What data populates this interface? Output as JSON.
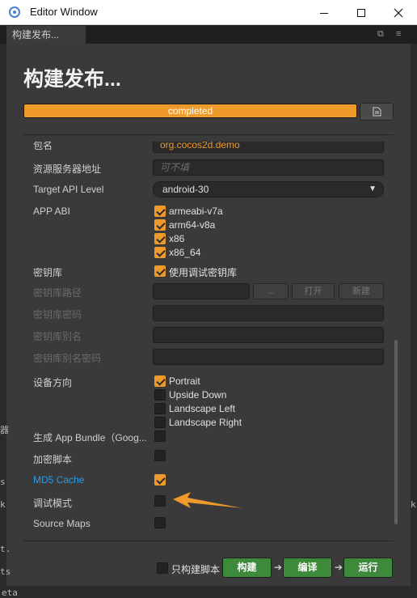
{
  "window": {
    "title": "Editor Window"
  },
  "tab": {
    "label": "构建发布..."
  },
  "panel": {
    "heading": "构建发布...",
    "progress": {
      "label": "completed",
      "percent": 100
    }
  },
  "form": {
    "package_name": {
      "label": "包名",
      "value": "org.cocos2d.demo"
    },
    "resource_server": {
      "label": "资源服务器地址",
      "placeholder": "可不填"
    },
    "target_api": {
      "label": "Target API Level",
      "value": "android-30"
    },
    "app_abi": {
      "label": "APP ABI",
      "options": [
        {
          "label": "armeabi-v7a",
          "checked": true
        },
        {
          "label": "arm64-v8a",
          "checked": true
        },
        {
          "label": "x86",
          "checked": true
        },
        {
          "label": "x86_64",
          "checked": true
        }
      ]
    },
    "keystore": {
      "label": "密钥库",
      "option_label": "使用调试密钥库",
      "checked": true
    },
    "keystore_path": {
      "label": "密钥库路径",
      "dots_label": "...",
      "open_label": "打开",
      "new_label": "新建"
    },
    "keystore_password": {
      "label": "密钥库密码"
    },
    "keystore_alias": {
      "label": "密钥库别名"
    },
    "keystore_alias_password": {
      "label": "密钥库别名密码"
    },
    "orientation": {
      "label": "设备方向",
      "options": [
        {
          "label": "Portrait",
          "checked": true
        },
        {
          "label": "Upside Down",
          "checked": false
        },
        {
          "label": "Landscape Left",
          "checked": false
        },
        {
          "label": "Landscape Right",
          "checked": false
        }
      ]
    },
    "app_bundle": {
      "label": "生成 App Bundle（Goog...",
      "checked": false
    },
    "encrypt_js": {
      "label": "加密脚本",
      "checked": false
    },
    "md5_cache": {
      "label": "MD5 Cache",
      "checked": true
    },
    "debug_mode": {
      "label": "调试模式",
      "checked": false
    },
    "source_maps": {
      "label": "Source Maps",
      "checked": false
    }
  },
  "footer": {
    "build_scripts_only_label": "只构建脚本",
    "build_scripts_only_checked": false,
    "build_label": "构建",
    "compile_label": "编译",
    "run_label": "运行",
    "arrow_glyph": "➔"
  },
  "colors": {
    "accent": "#f09a2c",
    "link": "#2c9ce8",
    "green_button": "#3d8a3a"
  },
  "background": {
    "edge_left": [
      "器",
      "s",
      "k",
      "",
      "t.",
      "ts"
    ],
    "edge_bottom": "eta"
  }
}
